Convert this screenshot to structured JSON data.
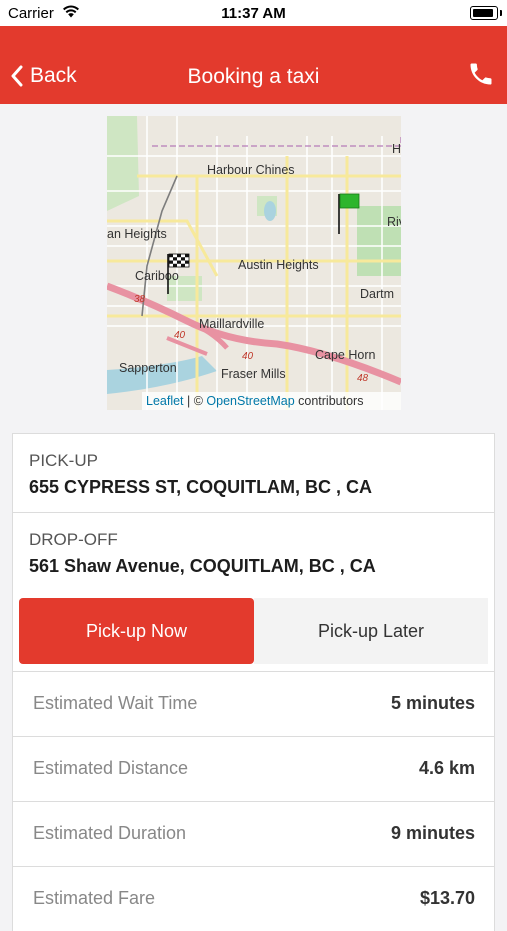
{
  "status_bar": {
    "carrier": "Carrier",
    "time": "11:37 AM"
  },
  "nav": {
    "back_label": "Back",
    "title": "Booking a taxi"
  },
  "map": {
    "labels": [
      "Harbour Chines",
      "an Heights",
      "Cariboo",
      "Austin Heights",
      "Dartm",
      "Maillardville",
      "Cape Horn",
      "Sapperton",
      "Fraser Mills",
      "H",
      "Riv"
    ],
    "route_numbers": [
      "38",
      "40",
      "40",
      "48"
    ],
    "attribution": {
      "leaflet": "Leaflet",
      "separator": " | © ",
      "osm": "OpenStreetMap",
      "suffix": " contributors"
    },
    "colors": {
      "pickup_flag": "checkered",
      "dropoff_flag": "#2db52d"
    }
  },
  "pickup": {
    "label": "PICK-UP",
    "address": "655 CYPRESS ST, COQUITLAM, BC , CA"
  },
  "dropoff": {
    "label": "DROP-OFF",
    "address": "561 Shaw Avenue, COQUITLAM, BC , CA"
  },
  "segment": {
    "now_label": "Pick-up Now",
    "later_label": "Pick-up Later",
    "selected": "now"
  },
  "estimates": [
    {
      "label": "Estimated Wait Time",
      "value": "5 minutes"
    },
    {
      "label": "Estimated Distance",
      "value": "4.6 km"
    },
    {
      "label": "Estimated Duration",
      "value": "9 minutes"
    },
    {
      "label": "Estimated Fare",
      "value": "$13.70"
    }
  ],
  "colors": {
    "accent": "#e33a2d",
    "background": "#f3f3f5"
  }
}
